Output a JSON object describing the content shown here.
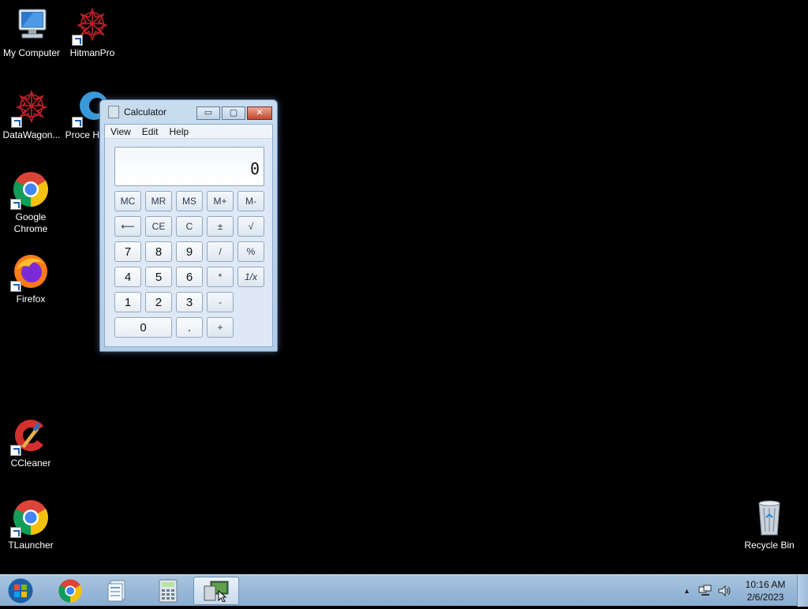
{
  "desktop": {
    "icons": [
      {
        "label": "My Computer"
      },
      {
        "label": "HitmanPro"
      },
      {
        "label": "DataWagon..."
      },
      {
        "label": "Proce Hacke"
      },
      {
        "label": "Google Chrome"
      },
      {
        "label": "Firefox"
      },
      {
        "label": "CCleaner"
      },
      {
        "label": "TLauncher"
      },
      {
        "label": "Recycle Bin"
      }
    ]
  },
  "calculator": {
    "title": "Calculator",
    "menu": [
      "View",
      "Edit",
      "Help"
    ],
    "display": "0",
    "window_buttons": {
      "minimize": "▭",
      "maximize": "▢",
      "close": "✕"
    },
    "keys": {
      "mc": "MC",
      "mr": "MR",
      "ms": "MS",
      "mplus": "M+",
      "mminus": "M-",
      "back": "⟵",
      "ce": "CE",
      "c": "C",
      "pm": "±",
      "sqrt": "√",
      "k7": "7",
      "k8": "8",
      "k9": "9",
      "div": "/",
      "pct": "%",
      "k4": "4",
      "k5": "5",
      "k6": "6",
      "mul": "*",
      "inv": "1/x",
      "k1": "1",
      "k2": "2",
      "k3": "3",
      "sub": "-",
      "k0": "0",
      "dot": ".",
      "add": "+",
      "eq": "="
    }
  },
  "taskbar": {
    "clock_time": "10:16 AM",
    "clock_date": "2/6/2023",
    "tray_chevron": "▲"
  },
  "colors": {
    "desktop_bg": "#000000",
    "taskbar": "#a9c5df",
    "close_button": "#c4472c"
  }
}
